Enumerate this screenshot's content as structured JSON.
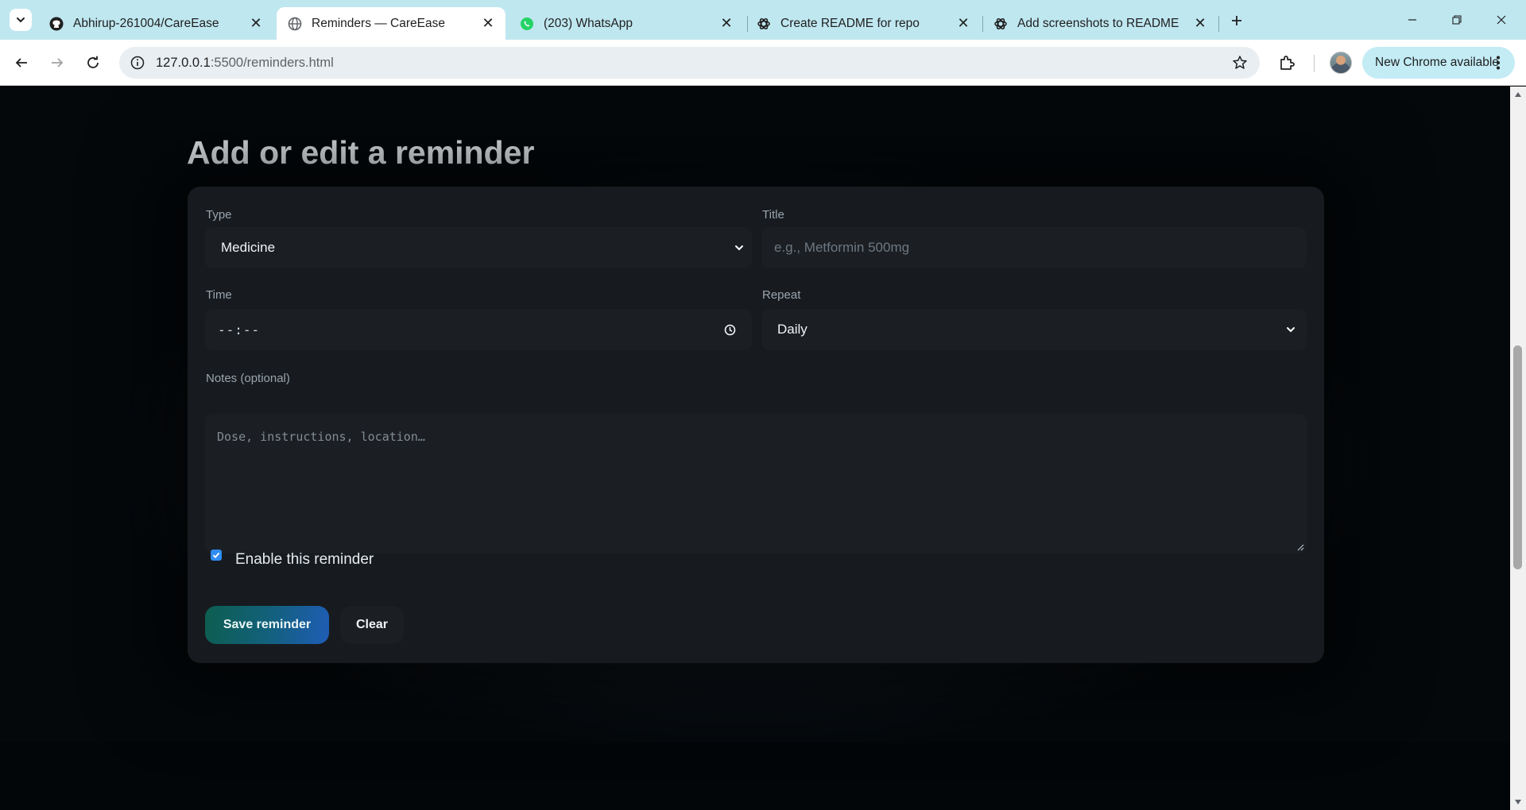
{
  "browser": {
    "tabs": [
      {
        "title": "Abhirup-261004/CareEase",
        "icon": "github-icon",
        "active": false
      },
      {
        "title": "Reminders — CareEase",
        "icon": "globe-icon",
        "active": true
      },
      {
        "title": "(203) WhatsApp",
        "icon": "whatsapp-icon",
        "active": false
      },
      {
        "title": "Create README for repo",
        "icon": "chatgpt-icon",
        "active": false
      },
      {
        "title": "Add screenshots to README",
        "icon": "chatgpt-icon",
        "active": false
      }
    ],
    "url": {
      "host": "127.0.0.1",
      "path": ":5500/reminders.html"
    },
    "update_label": "New Chrome available"
  },
  "page": {
    "heading": "Add or edit a reminder",
    "form": {
      "type_label": "Type",
      "type_value": "Medicine",
      "title_label": "Title",
      "title_placeholder": "e.g., Metformin 500mg",
      "time_label": "Time",
      "time_value": "--:--",
      "repeat_label": "Repeat",
      "repeat_value": "Daily",
      "notes_label": "Notes (optional)",
      "notes_placeholder": "Dose, instructions, location…",
      "enable_label": "Enable this reminder",
      "enable_checked": true,
      "save_label": "Save reminder",
      "clear_label": "Clear"
    }
  },
  "colors": {
    "page_bg": "#04080b",
    "card_bg": "#171b20",
    "field_bg": "#1b1f24",
    "accent_blue": "#2f8cf2",
    "save_gradient_start": "#0d5e4f",
    "save_gradient_end": "#1f5db6",
    "tabstrip_bg": "#bfe7f0"
  }
}
